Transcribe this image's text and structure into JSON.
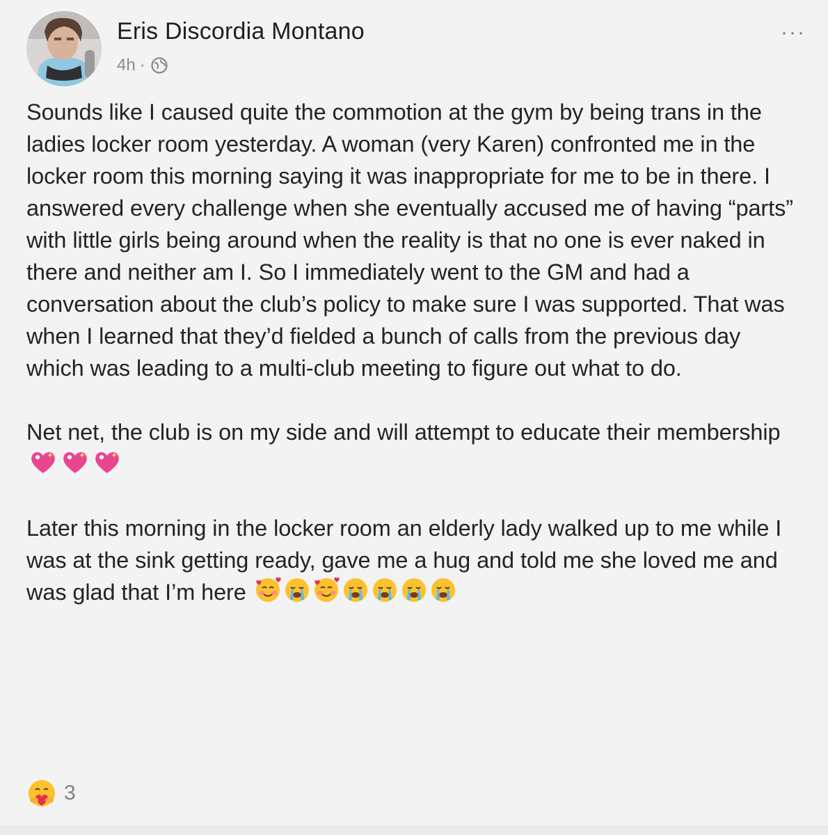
{
  "post": {
    "author_name": "Eris Discordia Montano",
    "timestamp": "4h",
    "separator": "·",
    "privacy_icon": "globe-icon",
    "more_label": "···",
    "paragraphs": [
      "Sounds like I caused quite the commotion at the gym by being trans in the ladies locker room yesterday. A woman (very Karen) confronted me in the locker room this morning saying it was inappropriate for me to be in there. I answered every challenge when she eventually accused me of having “parts” with little girls being around when the reality is that no one is ever naked in there and neither am I. So I immediately went to the GM and had a conversation about the club’s policy to make sure I was supported. That was when I learned that they’d fielded a bunch of calls from the previous day which was leading to a multi-club meeting to figure out what to do.",
      "Net net, the club is on my side and will attempt to educate their membership",
      "Later this morning in the locker room an elderly lady walked up to me while I was at the sink getting ready, gave me a hug and told me she loved me and was glad that I’m here"
    ],
    "p2_emojis": [
      "sparkling-heart-emoji",
      "sparkling-heart-emoji",
      "sparkling-heart-emoji"
    ],
    "p3_emojis": [
      "smiling-face-with-hearts-emoji",
      "loudly-crying-face-emoji",
      "smiling-face-with-hearts-emoji",
      "loudly-crying-face-emoji",
      "loudly-crying-face-emoji",
      "loudly-crying-face-emoji",
      "loudly-crying-face-emoji"
    ],
    "reaction_icon": "care-reaction-icon",
    "reaction_count": "3"
  },
  "colors": {
    "background": "#f3f3f3",
    "text": "#232323",
    "meta": "#8a8a8a",
    "heart": "#e83e8c"
  }
}
